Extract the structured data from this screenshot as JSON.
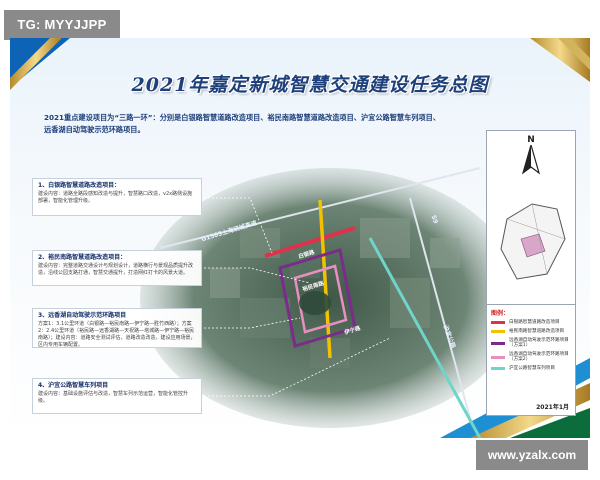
{
  "watermarks": {
    "top": "TG: MYYJJPP",
    "bottom": "www.yzalx.com"
  },
  "poster": {
    "title": "2021年嘉定新城智慧交通建设任务总图",
    "intro_line1": "2021重点建设项目为“三路一环”：分别是白银路智慧道路改造项目、裕民南路智慧道路改造项目、沪宜公路智慧车列项目、",
    "intro_line2": "远香湖自动驾驶示范环路项目。",
    "callouts": [
      {
        "title": "1、白银路智慧道路改造项目：",
        "body": "建设内容：道路全路段感知改造与提升，智慧路口改造，v2x路侧设施部署，智能化管理升级。"
      },
      {
        "title": "2、裕民南路智慧道路改造项目：",
        "body": "建设内容：完整道路交通设计与规划设计，道路横行与景观品质提升改造，沿线公园支路打通，智慧交通提升，打造网红打卡的风景大道。"
      },
      {
        "title": "3、远香湖自动驾驶示范环路项目",
        "body": "方案1：3.1公里环道（白银路—裕民南路—伊宁路—胜竹西路）；方案2：2.4公里环道（裕民路—远香湖路—天祝路—塔城路—伊宁路—裕民南路）；建设内容：道路安全测试评估，道路改造改造，建设应用场景，区内专用车辆配置。"
      },
      {
        "title": "4、沪宜公路智慧车列项目",
        "body": "建设内容：基础设施评估与改造，智慧车列示范运营，智能化管控升级。"
      }
    ],
    "map_labels": {
      "g1503": "G1503上海绕城高速",
      "huyi": "沪宜公路",
      "s9": "S9",
      "baiyin": "白银路",
      "yumin": "裕民南路",
      "yixiang": "伊宁路"
    },
    "inset": {
      "north": "N"
    },
    "legend": {
      "title": "图例：",
      "items": [
        {
          "label": "白银路智慧道路改造项目",
          "color": "#e0314b"
        },
        {
          "label": "裕民南路智慧道路改造项目",
          "color": "#f2c200"
        },
        {
          "label": "远香湖自动驾驶示范环路项目（方案1）",
          "color": "#7b2b8a"
        },
        {
          "label": "远香湖自动驾驶示范环路项目（方案2）",
          "color": "#e88fbf"
        },
        {
          "label": "沪宜公路智慧车列项目",
          "color": "#6fd4c9"
        }
      ],
      "date": "2021年1月"
    }
  }
}
